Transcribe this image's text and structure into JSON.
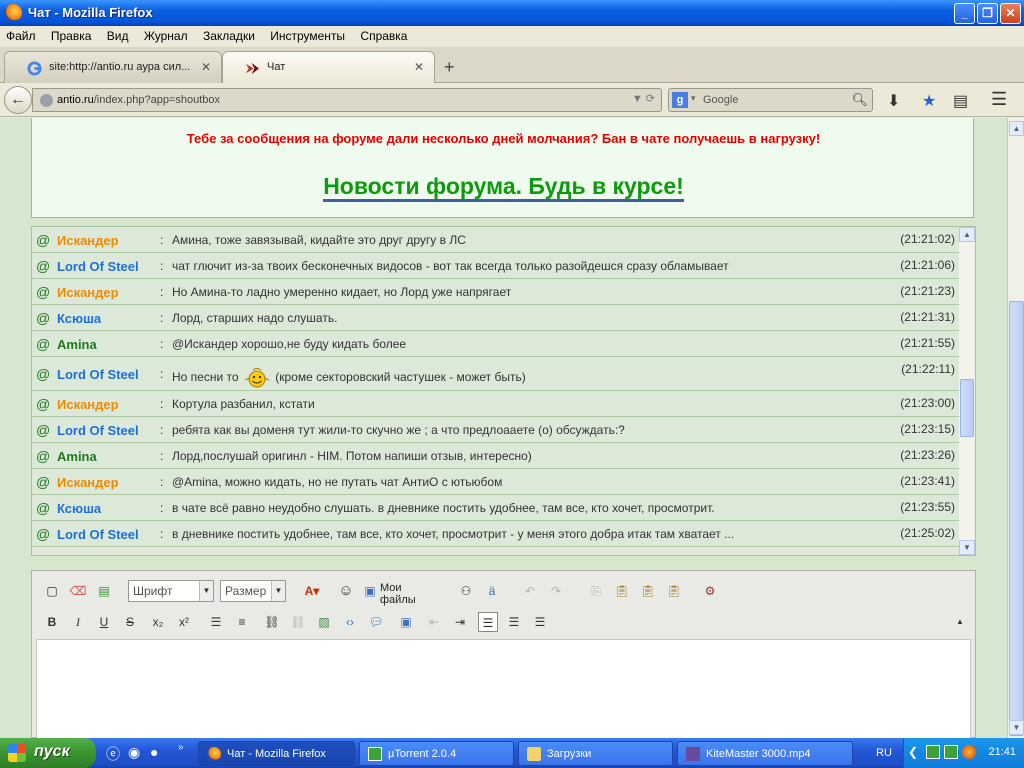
{
  "window": {
    "title": "Чат - Mozilla Firefox"
  },
  "menu": [
    "Файл",
    "Правка",
    "Вид",
    "Журнал",
    "Закладки",
    "Инструменты",
    "Справка"
  ],
  "tabs": [
    {
      "label": "site:http://antio.ru аура сил...",
      "active": false
    },
    {
      "label": "Чат",
      "active": true
    }
  ],
  "nav": {
    "url_domain": "antio.ru",
    "url_path": "/index.php?app=shoutbox",
    "search_placeholder": "Google"
  },
  "page": {
    "warning": "Тебе за сообщения на форуме дали несколько дней молчания? Бан в чате получаешь в нагрузку!",
    "news_link": "Новости форума. Будь в курсе!"
  },
  "chat": {
    "messages": [
      {
        "user": "Искандер",
        "color": "#f08a00",
        "text": "Амина, тоже завязывай, кидайте это друг другу в ЛС",
        "time": "(21:21:02)"
      },
      {
        "user": "Lord Of Steel",
        "color": "#1f6fd4",
        "text": "чат глючит из-за твоих бесконечных видосов - вот так всегда только разойдешся сразу обламывает",
        "time": "(21:21:06)"
      },
      {
        "user": "Искандер",
        "color": "#f08a00",
        "text": "Но Амина-то ладно умеренно кидает, но Лорд уже напрягает",
        "time": "(21:21:23)"
      },
      {
        "user": "Ксюша",
        "color": "#1f6fd4",
        "text": "Лорд, старших надо слушать.",
        "time": "(21:21:31)"
      },
      {
        "user": "Amina",
        "color": "#1f7a1f",
        "text": "@Искандер хорошо,не буду кидать более",
        "time": "(21:21:55)"
      },
      {
        "user": "Lord Of Steel",
        "color": "#1f6fd4",
        "text": "Но песни то",
        "text2": "(кроме секторовский частушек - может быть)",
        "time": "(21:22:11)",
        "smiley": true
      },
      {
        "user": "Искандер",
        "color": "#f08a00",
        "text": "Кортула разбанил, кстати",
        "time": "(21:23:00)"
      },
      {
        "user": "Lord Of Steel",
        "color": "#1f6fd4",
        "text": "ребята как вы доменя тут жили-то скучно же ; а что предлоааете (о) обсуждать:?",
        "time": "(21:23:15)"
      },
      {
        "user": "Amina",
        "color": "#1f7a1f",
        "text": "Лорд,послушай оригинл - HIM. Потом напиши отзыв, интересно)",
        "time": "(21:23:26)"
      },
      {
        "user": "Искандер",
        "color": "#f08a00",
        "text": "@Amina, можно кидать, но не путать чат АнтиО с ютьюбом",
        "time": "(21:23:41)"
      },
      {
        "user": "Ксюша",
        "color": "#1f6fd4",
        "text": "в чате всё равно неудобно слушать. в дневнике постить удобнее, там все, кто хочет, просмотрит.",
        "time": "(21:23:55)"
      },
      {
        "user": "Lord Of Steel",
        "color": "#1f6fd4",
        "text": "в дневнике постить удобнее, там все, кто хочет, просмотрит - у меня этого добра итак там хватает ...",
        "time": "(21:25:02)"
      }
    ]
  },
  "editor": {
    "font_combo": "Шрифт",
    "size_combo": "Размер",
    "my_files": "Мои файлы"
  },
  "taskbar": {
    "start_label": "пуск",
    "tasks": [
      {
        "label": "Чат - Mozilla Firefox",
        "active": true
      },
      {
        "label": "µTorrent 2.0.4",
        "active": false
      },
      {
        "label": "Загрузки",
        "active": false
      },
      {
        "label": "KiteMaster 3000.mp4",
        "active": false
      }
    ],
    "lang": "RU",
    "clock": "21:41"
  }
}
